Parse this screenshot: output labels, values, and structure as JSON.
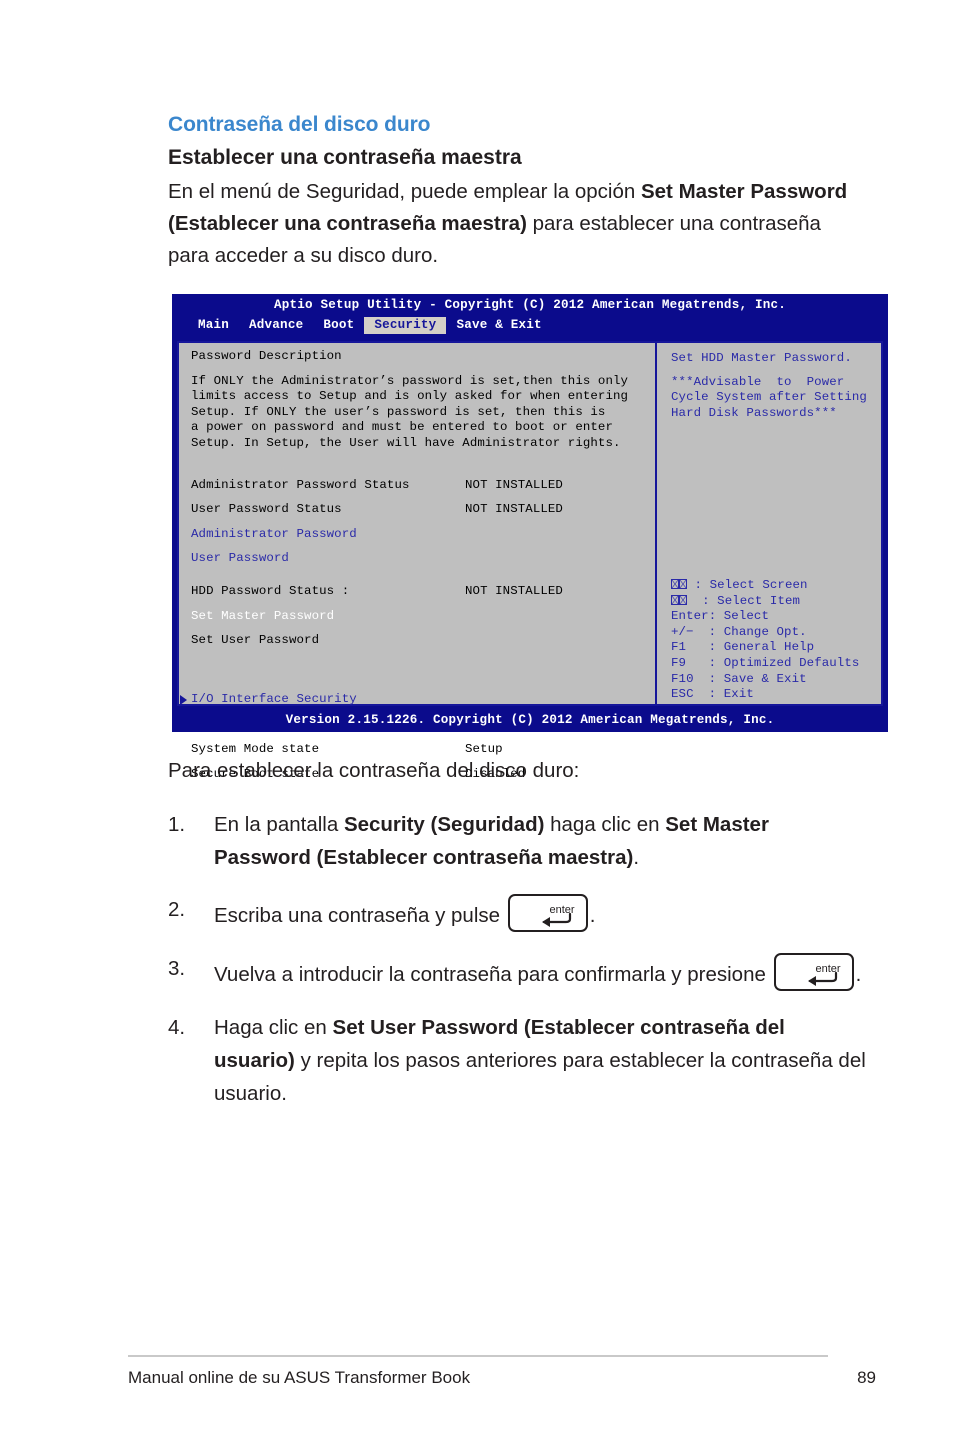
{
  "section": {
    "heading": "Contraseña del disco duro",
    "subheading": "Establecer una contraseña maestra",
    "intro_1": "En el menú de Seguridad, puede emplear la opción ",
    "intro_bold_1": "Set Master Password (Establecer una contraseña maestra)",
    "intro_2": " para establecer una contraseña para acceder a su disco duro."
  },
  "bios": {
    "title": "Aptio Setup Utility - Copyright (C) 2012 American Megatrends, Inc.",
    "menu": [
      {
        "label": "Main",
        "selected": false
      },
      {
        "label": "Advance",
        "selected": false
      },
      {
        "label": "Boot",
        "selected": false
      },
      {
        "label": "Security",
        "selected": true
      },
      {
        "label": "Save & Exit",
        "selected": false
      }
    ],
    "panel_heading": "Password Description",
    "description": [
      "If ONLY the Administrator’s password is set,then this only",
      "limits access to Setup and is only asked for when entering",
      "Setup. If ONLY the user’s password is set, then this is",
      "a power on password and must be entered to boot or enter",
      "Setup. In Setup, the User will have Administrator rights."
    ],
    "fields": [
      {
        "label": "Administrator Password Status",
        "value": "NOT INSTALLED",
        "style": "plain"
      },
      {
        "label": "User Password Status",
        "value": "NOT INSTALLED",
        "style": "plain"
      },
      {
        "label": "Administrator Password",
        "value": "",
        "style": "link"
      },
      {
        "label": "User Password",
        "value": "",
        "style": "link"
      }
    ],
    "hdd_fields": [
      {
        "label": "HDD Password Status :",
        "value": "NOT INSTALLED",
        "style": "plain"
      },
      {
        "label": "Set Master Password",
        "value": "",
        "style": "selected"
      },
      {
        "label": "Set User Password",
        "value": "",
        "style": "plain"
      }
    ],
    "submenu": {
      "label": "I/O Interface Security"
    },
    "state_fields": [
      {
        "label": "System Mode state",
        "value": "Setup"
      },
      {
        "label": "Secure Boot state",
        "value": "Disabled"
      }
    ],
    "help": {
      "title": "Set HDD Master Password.",
      "note": [
        "***Advisable  to  Power",
        "Cycle System after Setting",
        "Hard Disk Passwords***"
      ]
    },
    "keys": [
      {
        "key": "↔",
        "glyph": "box",
        "sep": " : ",
        "action": "Select Screen"
      },
      {
        "key": "↕",
        "glyph": "box",
        "sep": "  : ",
        "action": "Select Item"
      },
      {
        "key": "Enter",
        "glyph": "text",
        "sep": ": ",
        "action": "Select"
      },
      {
        "key": "+/−",
        "glyph": "text",
        "sep": "  : ",
        "action": "Change Opt."
      },
      {
        "key": "F1",
        "glyph": "text",
        "sep": "   : ",
        "action": "General Help"
      },
      {
        "key": "F9",
        "glyph": "text",
        "sep": "   : ",
        "action": "Optimized Defaults"
      },
      {
        "key": "F10",
        "glyph": "text",
        "sep": "  : ",
        "action": "Save & Exit"
      },
      {
        "key": "ESC",
        "glyph": "text",
        "sep": "  : ",
        "action": "Exit"
      }
    ],
    "version": "Version 2.15.1226. Copyright (C) 2012 American Megatrends, Inc."
  },
  "instructions": {
    "lead": "Para establecer la contraseña del disco duro:",
    "items": [
      {
        "number": "1.",
        "parts": [
          {
            "t": "En la pantalla ",
            "b": false
          },
          {
            "t": "Security (Seguridad)",
            "b": true
          },
          {
            "t": " haga clic en ",
            "b": false
          },
          {
            "t": "Set Master Password (Establecer contraseña maestra)",
            "b": true
          },
          {
            "t": ".",
            "b": false
          }
        ]
      },
      {
        "number": "2.",
        "parts": [
          {
            "t": "Escriba una contraseña y pulse ",
            "b": false
          },
          {
            "t": "[enter-key]",
            "b": false,
            "key": true
          },
          {
            "t": ".",
            "b": false
          }
        ]
      },
      {
        "number": "3.",
        "parts": [
          {
            "t": "Vuelva a introducir la contraseña para confirmarla y presione ",
            "b": false
          },
          {
            "t": "[enter-key]",
            "b": false,
            "key": true
          },
          {
            "t": ".",
            "b": false
          }
        ]
      },
      {
        "number": "4.",
        "parts": [
          {
            "t": "Haga clic en ",
            "b": false
          },
          {
            "t": "Set User Password (Establecer contraseña del usuario)",
            "b": true
          },
          {
            "t": " y repita los pasos anteriores para establecer la contraseña del usuario.",
            "b": false
          }
        ]
      }
    ],
    "enter_key_label": "enter"
  },
  "footer": {
    "text": "Manual online de su ASUS Transformer Book",
    "page": "89"
  },
  "colors": {
    "heading_blue": "#3b87cd",
    "bios_bg": "#0b0b8c",
    "bios_panel": "#bfbfbf",
    "bios_link": "#2a2aa8",
    "tab_selected_bg": "#d4d0c8"
  }
}
